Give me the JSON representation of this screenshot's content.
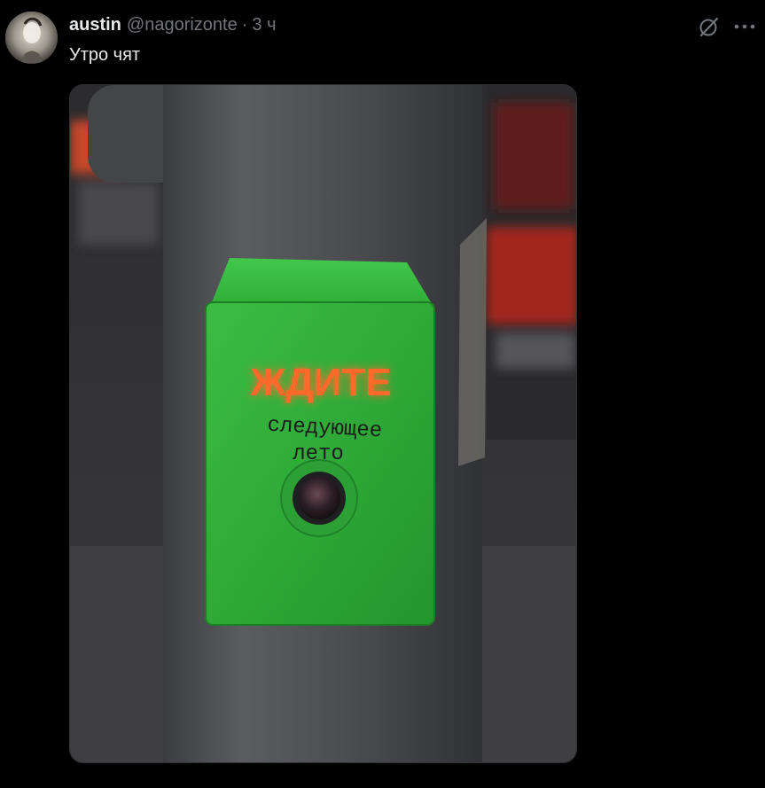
{
  "tweet": {
    "author": {
      "display_name": "austin",
      "handle": "@nagorizonte"
    },
    "separator": "·",
    "time": "3 ч",
    "text": "Утро чят"
  },
  "icons": {
    "grok": "grok-slash-circle-icon",
    "more": "more-horizontal-icon"
  },
  "media": {
    "sign_text": "ЖДИТЕ",
    "handwritten_line_1": "следующее",
    "handwritten_line_2": "лето"
  },
  "colors": {
    "background": "#000000",
    "primary_text": "#e7e9ea",
    "secondary_text": "#71767b",
    "button_green": "#2fae3a",
    "glow_red": "#ff5a1f"
  }
}
